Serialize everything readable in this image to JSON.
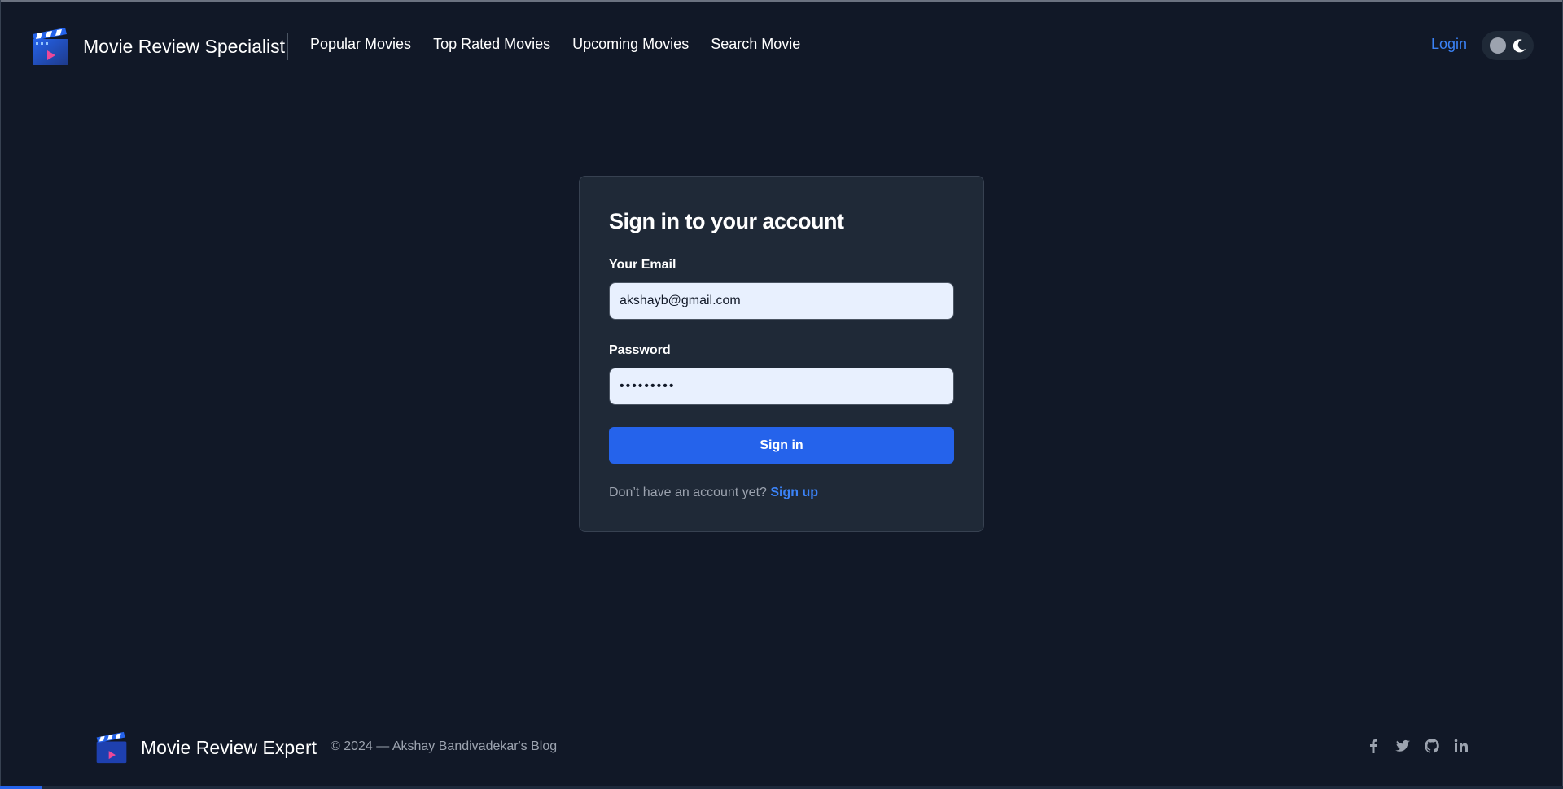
{
  "header": {
    "brand_title": "Movie Review Specialist",
    "nav": [
      {
        "label": "Popular Movies"
      },
      {
        "label": "Top Rated Movies"
      },
      {
        "label": "Upcoming Movies"
      },
      {
        "label": "Search Movie"
      }
    ],
    "login_label": "Login",
    "icons": {
      "logo": "clapperboard-logo-icon",
      "theme": "moon-icon"
    }
  },
  "form": {
    "title": "Sign in to your account",
    "email_label": "Your Email",
    "email_value": "akshayb@gmail.com",
    "password_label": "Password",
    "password_value": "•••••••••",
    "submit_label": "Sign in",
    "signup_prompt": "Don’t have an account yet?",
    "signup_link": "Sign up"
  },
  "footer": {
    "brand_title": "Movie Review Expert",
    "copyright": "© 2024 — Akshay Bandivadekar's Blog",
    "socials": [
      "facebook-icon",
      "twitter-icon",
      "github-icon",
      "linkedin-icon"
    ]
  },
  "colors": {
    "background": "#111827",
    "card": "#1f2937",
    "accent": "#2563eb",
    "link": "#3b82f6",
    "muted": "#9ca3af"
  }
}
